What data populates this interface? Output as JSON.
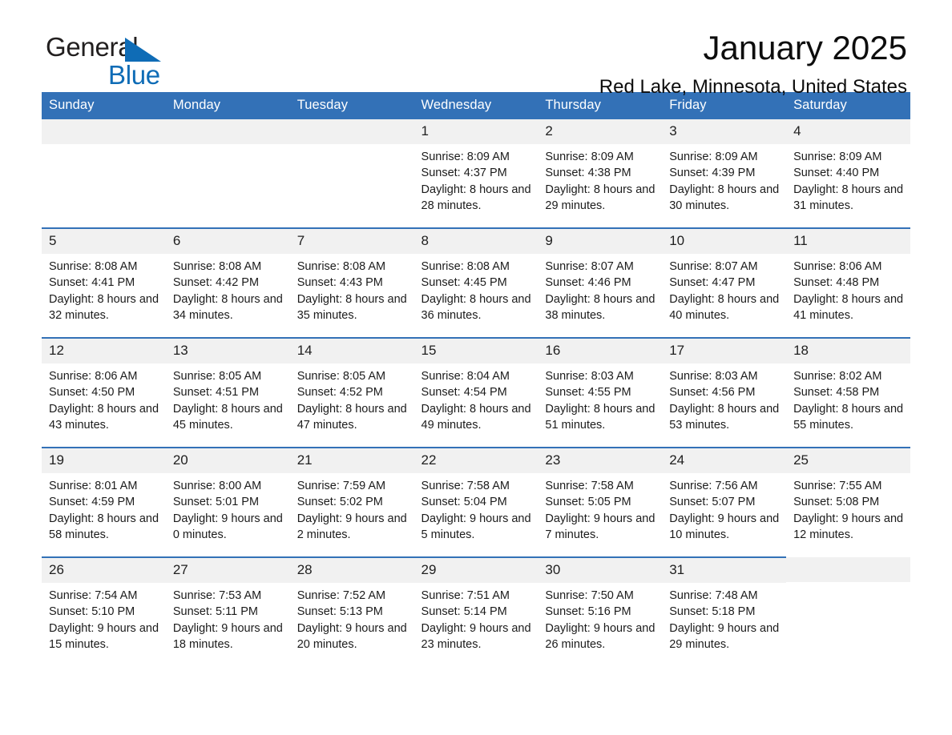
{
  "brand": {
    "name_part1": "General",
    "name_part2": "Blue",
    "accent_color": "#0f6cb6"
  },
  "header": {
    "month_title": "January 2025",
    "location": "Red Lake, Minnesota, United States"
  },
  "calendar": {
    "header_bg": "#3371b7",
    "weekdays": [
      "Sunday",
      "Monday",
      "Tuesday",
      "Wednesday",
      "Thursday",
      "Friday",
      "Saturday"
    ],
    "weeks": [
      [
        {
          "day": "",
          "sunrise": "",
          "sunset": "",
          "daylight": "",
          "empty": true
        },
        {
          "day": "",
          "sunrise": "",
          "sunset": "",
          "daylight": "",
          "empty": true
        },
        {
          "day": "",
          "sunrise": "",
          "sunset": "",
          "daylight": "",
          "empty": true
        },
        {
          "day": "1",
          "sunrise": "Sunrise: 8:09 AM",
          "sunset": "Sunset: 4:37 PM",
          "daylight": "Daylight: 8 hours and 28 minutes."
        },
        {
          "day": "2",
          "sunrise": "Sunrise: 8:09 AM",
          "sunset": "Sunset: 4:38 PM",
          "daylight": "Daylight: 8 hours and 29 minutes."
        },
        {
          "day": "3",
          "sunrise": "Sunrise: 8:09 AM",
          "sunset": "Sunset: 4:39 PM",
          "daylight": "Daylight: 8 hours and 30 minutes."
        },
        {
          "day": "4",
          "sunrise": "Sunrise: 8:09 AM",
          "sunset": "Sunset: 4:40 PM",
          "daylight": "Daylight: 8 hours and 31 minutes."
        }
      ],
      [
        {
          "day": "5",
          "sunrise": "Sunrise: 8:08 AM",
          "sunset": "Sunset: 4:41 PM",
          "daylight": "Daylight: 8 hours and 32 minutes."
        },
        {
          "day": "6",
          "sunrise": "Sunrise: 8:08 AM",
          "sunset": "Sunset: 4:42 PM",
          "daylight": "Daylight: 8 hours and 34 minutes."
        },
        {
          "day": "7",
          "sunrise": "Sunrise: 8:08 AM",
          "sunset": "Sunset: 4:43 PM",
          "daylight": "Daylight: 8 hours and 35 minutes."
        },
        {
          "day": "8",
          "sunrise": "Sunrise: 8:08 AM",
          "sunset": "Sunset: 4:45 PM",
          "daylight": "Daylight: 8 hours and 36 minutes."
        },
        {
          "day": "9",
          "sunrise": "Sunrise: 8:07 AM",
          "sunset": "Sunset: 4:46 PM",
          "daylight": "Daylight: 8 hours and 38 minutes."
        },
        {
          "day": "10",
          "sunrise": "Sunrise: 8:07 AM",
          "sunset": "Sunset: 4:47 PM",
          "daylight": "Daylight: 8 hours and 40 minutes."
        },
        {
          "day": "11",
          "sunrise": "Sunrise: 8:06 AM",
          "sunset": "Sunset: 4:48 PM",
          "daylight": "Daylight: 8 hours and 41 minutes."
        }
      ],
      [
        {
          "day": "12",
          "sunrise": "Sunrise: 8:06 AM",
          "sunset": "Sunset: 4:50 PM",
          "daylight": "Daylight: 8 hours and 43 minutes."
        },
        {
          "day": "13",
          "sunrise": "Sunrise: 8:05 AM",
          "sunset": "Sunset: 4:51 PM",
          "daylight": "Daylight: 8 hours and 45 minutes."
        },
        {
          "day": "14",
          "sunrise": "Sunrise: 8:05 AM",
          "sunset": "Sunset: 4:52 PM",
          "daylight": "Daylight: 8 hours and 47 minutes."
        },
        {
          "day": "15",
          "sunrise": "Sunrise: 8:04 AM",
          "sunset": "Sunset: 4:54 PM",
          "daylight": "Daylight: 8 hours and 49 minutes."
        },
        {
          "day": "16",
          "sunrise": "Sunrise: 8:03 AM",
          "sunset": "Sunset: 4:55 PM",
          "daylight": "Daylight: 8 hours and 51 minutes."
        },
        {
          "day": "17",
          "sunrise": "Sunrise: 8:03 AM",
          "sunset": "Sunset: 4:56 PM",
          "daylight": "Daylight: 8 hours and 53 minutes."
        },
        {
          "day": "18",
          "sunrise": "Sunrise: 8:02 AM",
          "sunset": "Sunset: 4:58 PM",
          "daylight": "Daylight: 8 hours and 55 minutes."
        }
      ],
      [
        {
          "day": "19",
          "sunrise": "Sunrise: 8:01 AM",
          "sunset": "Sunset: 4:59 PM",
          "daylight": "Daylight: 8 hours and 58 minutes."
        },
        {
          "day": "20",
          "sunrise": "Sunrise: 8:00 AM",
          "sunset": "Sunset: 5:01 PM",
          "daylight": "Daylight: 9 hours and 0 minutes."
        },
        {
          "day": "21",
          "sunrise": "Sunrise: 7:59 AM",
          "sunset": "Sunset: 5:02 PM",
          "daylight": "Daylight: 9 hours and 2 minutes."
        },
        {
          "day": "22",
          "sunrise": "Sunrise: 7:58 AM",
          "sunset": "Sunset: 5:04 PM",
          "daylight": "Daylight: 9 hours and 5 minutes."
        },
        {
          "day": "23",
          "sunrise": "Sunrise: 7:58 AM",
          "sunset": "Sunset: 5:05 PM",
          "daylight": "Daylight: 9 hours and 7 minutes."
        },
        {
          "day": "24",
          "sunrise": "Sunrise: 7:56 AM",
          "sunset": "Sunset: 5:07 PM",
          "daylight": "Daylight: 9 hours and 10 minutes."
        },
        {
          "day": "25",
          "sunrise": "Sunrise: 7:55 AM",
          "sunset": "Sunset: 5:08 PM",
          "daylight": "Daylight: 9 hours and 12 minutes."
        }
      ],
      [
        {
          "day": "26",
          "sunrise": "Sunrise: 7:54 AM",
          "sunset": "Sunset: 5:10 PM",
          "daylight": "Daylight: 9 hours and 15 minutes."
        },
        {
          "day": "27",
          "sunrise": "Sunrise: 7:53 AM",
          "sunset": "Sunset: 5:11 PM",
          "daylight": "Daylight: 9 hours and 18 minutes."
        },
        {
          "day": "28",
          "sunrise": "Sunrise: 7:52 AM",
          "sunset": "Sunset: 5:13 PM",
          "daylight": "Daylight: 9 hours and 20 minutes."
        },
        {
          "day": "29",
          "sunrise": "Sunrise: 7:51 AM",
          "sunset": "Sunset: 5:14 PM",
          "daylight": "Daylight: 9 hours and 23 minutes."
        },
        {
          "day": "30",
          "sunrise": "Sunrise: 7:50 AM",
          "sunset": "Sunset: 5:16 PM",
          "daylight": "Daylight: 9 hours and 26 minutes."
        },
        {
          "day": "31",
          "sunrise": "Sunrise: 7:48 AM",
          "sunset": "Sunset: 5:18 PM",
          "daylight": "Daylight: 9 hours and 29 minutes."
        },
        {
          "day": "",
          "sunrise": "",
          "sunset": "",
          "daylight": "",
          "empty": true
        }
      ]
    ]
  }
}
